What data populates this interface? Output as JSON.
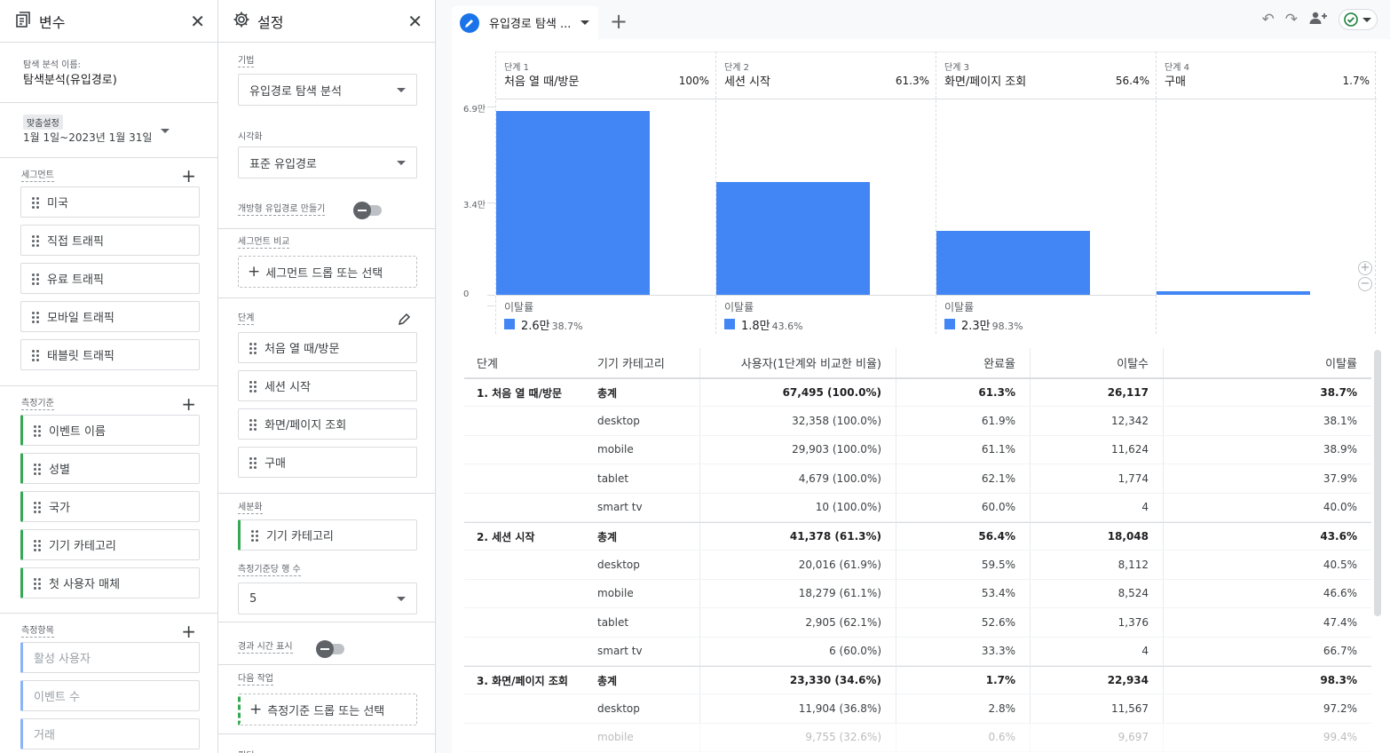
{
  "variables": {
    "title": "변수",
    "exploration_name_label": "탐색 분석 이름:",
    "exploration_name": "탐색분석(유입경로)",
    "date_tag": "맞춤설정",
    "date_range": "1월 1일~2023년 1월 31일",
    "segments_label": "세그먼트",
    "segments": [
      "미국",
      "직접 트래픽",
      "유료 트래픽",
      "모바일 트래픽",
      "태블릿 트래픽"
    ],
    "dimensions_label": "측정기준",
    "dimensions": [
      "이벤트 이름",
      "성별",
      "국가",
      "기기 카테고리",
      "첫 사용자 매체"
    ],
    "metrics_label": "측정항목",
    "metrics": [
      "활성 사용자",
      "이벤트 수",
      "거래"
    ]
  },
  "settings": {
    "title": "설정",
    "technique_label": "기법",
    "technique_value": "유입경로 탐색 분석",
    "visualization_label": "시각화",
    "visualization_value": "표준 유입경로",
    "open_funnel_label": "개방형 유입경로 만들기",
    "segment_compare_label": "세그먼트 비교",
    "segment_drop": "세그먼트 드롭 또는 선택",
    "steps_label": "단계",
    "steps": [
      "처음 열 때/방문",
      "세션 시작",
      "화면/페이지 조회",
      "구매"
    ],
    "breakdown_label": "세분화",
    "breakdown_value": "기기 카테고리",
    "rows_label": "측정기준당 행 수",
    "rows_value": "5",
    "elapsed_label": "경과 시간 표시",
    "next_action_label": "다음 작업",
    "next_action_drop": "측정기준 드롭 또는 선택",
    "bottom_label": "필터"
  },
  "tab": {
    "label": "유입경로 탐색 ..."
  },
  "chart_data": {
    "type": "bar",
    "categories": [
      "처음 열 때/방문",
      "세션 시작",
      "화면/페이지 조회",
      "구매"
    ],
    "step_labels": [
      "단계 1",
      "단계 2",
      "단계 3",
      "단계 4"
    ],
    "step_pct": [
      "100%",
      "61.3%",
      "56.4%",
      "1.7%"
    ],
    "values": [
      67495,
      41378,
      23330,
      1146
    ],
    "y_ticks": [
      "6.9만",
      "3.4만",
      "0"
    ],
    "y_tick_values": [
      69000,
      34000,
      0
    ],
    "ylim": [
      0,
      69000
    ],
    "dropoff_label": "이탈률",
    "dropoffs": [
      {
        "value": "2.6만",
        "pct": "38.7%"
      },
      {
        "value": "1.8만",
        "pct": "43.6%"
      },
      {
        "value": "2.3만",
        "pct": "98.3%"
      }
    ]
  },
  "table": {
    "headers": [
      "단계",
      "기기 카테고리",
      "사용자(1단계와 비교한 비율)",
      "완료율",
      "이탈수",
      "이탈률"
    ],
    "rows": [
      {
        "step": "1. 처음 열 때/방문",
        "device": "총계",
        "users": "67,495 (100.0%)",
        "completion": "61.3%",
        "drop": "26,117",
        "drop_rate": "38.7%",
        "total": true
      },
      {
        "step": "",
        "device": "desktop",
        "users": "32,358 (100.0%)",
        "completion": "61.9%",
        "drop": "12,342",
        "drop_rate": "38.1%"
      },
      {
        "step": "",
        "device": "mobile",
        "users": "29,903 (100.0%)",
        "completion": "61.1%",
        "drop": "11,624",
        "drop_rate": "38.9%"
      },
      {
        "step": "",
        "device": "tablet",
        "users": "4,679 (100.0%)",
        "completion": "62.1%",
        "drop": "1,774",
        "drop_rate": "37.9%"
      },
      {
        "step": "",
        "device": "smart tv",
        "users": "10 (100.0%)",
        "completion": "60.0%",
        "drop": "4",
        "drop_rate": "40.0%"
      },
      {
        "step": "2. 세션 시작",
        "device": "총계",
        "users": "41,378 (61.3%)",
        "completion": "56.4%",
        "drop": "18,048",
        "drop_rate": "43.6%",
        "total": true
      },
      {
        "step": "",
        "device": "desktop",
        "users": "20,016 (61.9%)",
        "completion": "59.5%",
        "drop": "8,112",
        "drop_rate": "40.5%"
      },
      {
        "step": "",
        "device": "mobile",
        "users": "18,279 (61.1%)",
        "completion": "53.4%",
        "drop": "8,524",
        "drop_rate": "46.6%"
      },
      {
        "step": "",
        "device": "tablet",
        "users": "2,905 (62.1%)",
        "completion": "52.6%",
        "drop": "1,376",
        "drop_rate": "47.4%"
      },
      {
        "step": "",
        "device": "smart tv",
        "users": "6 (60.0%)",
        "completion": "33.3%",
        "drop": "4",
        "drop_rate": "66.7%"
      },
      {
        "step": "3. 화면/페이지 조회",
        "device": "총계",
        "users": "23,330 (34.6%)",
        "completion": "1.7%",
        "drop": "22,934",
        "drop_rate": "98.3%",
        "total": true
      },
      {
        "step": "",
        "device": "desktop",
        "users": "11,904 (36.8%)",
        "completion": "2.8%",
        "drop": "11,567",
        "drop_rate": "97.2%"
      },
      {
        "step": "",
        "device": "mobile",
        "users": "9,755 (32.6%)",
        "completion": "0.6%",
        "drop": "9,697",
        "drop_rate": "99.4%",
        "faded": true
      }
    ]
  },
  "colors": {
    "bar": "#4285f4",
    "accent": "#1a73e8",
    "dimension_border": "#34a853",
    "metric_border": "#8ab4f8"
  }
}
